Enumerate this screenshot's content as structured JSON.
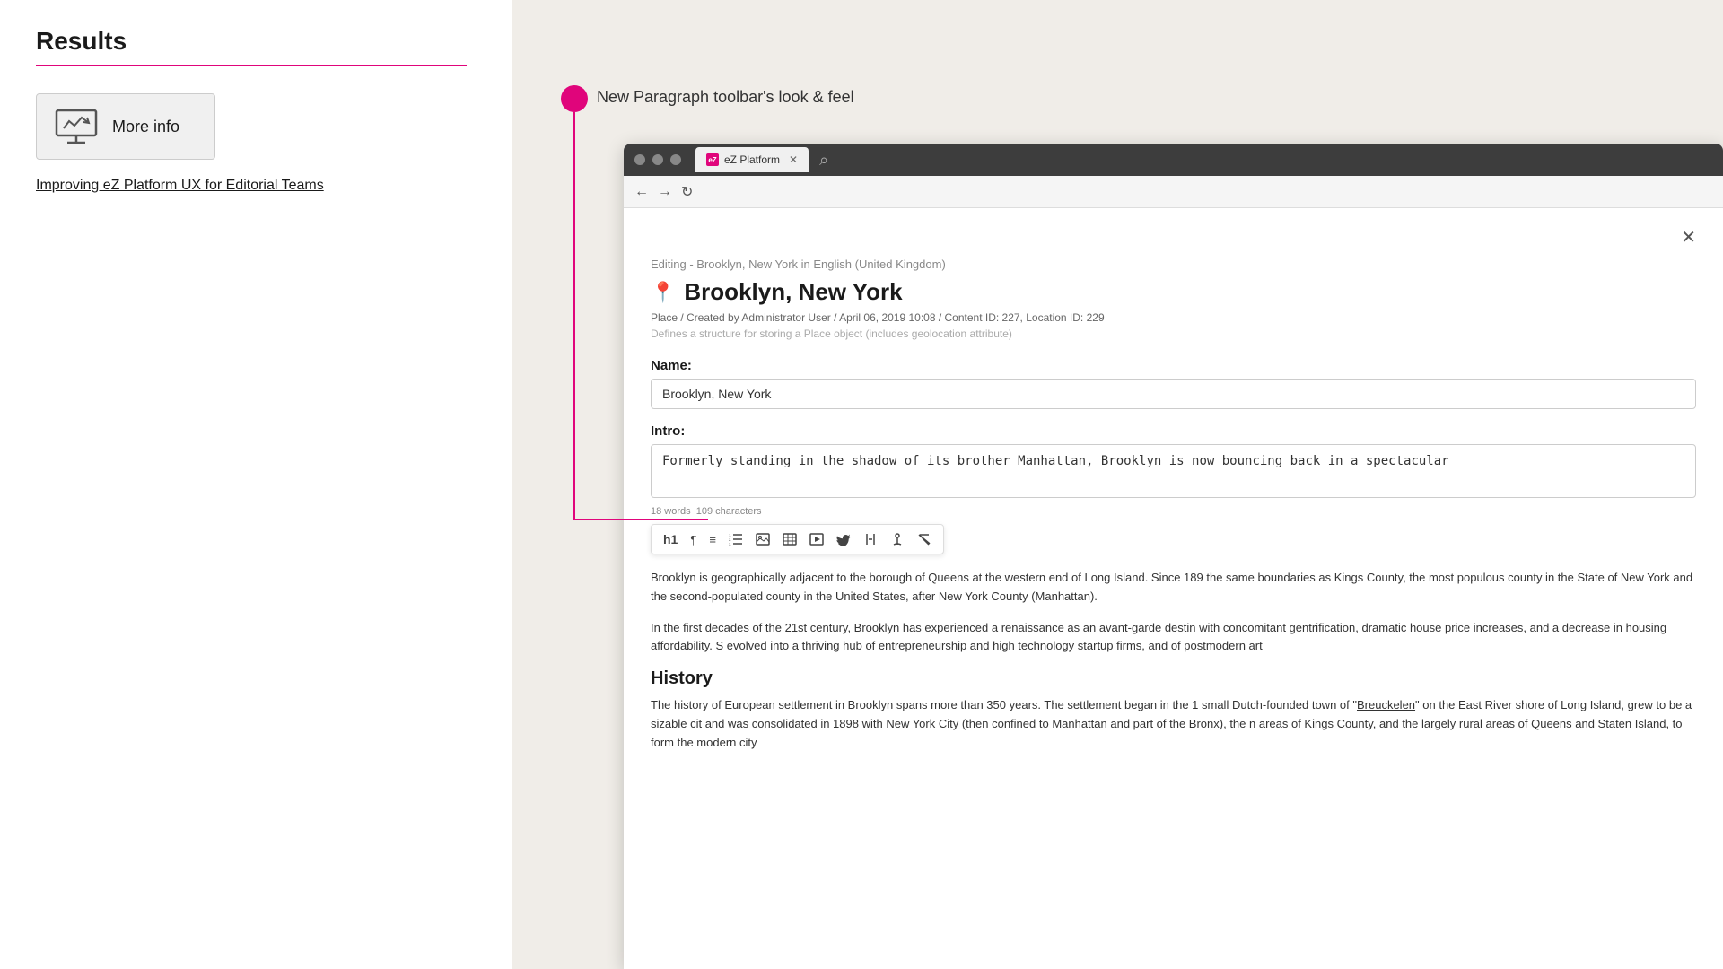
{
  "left": {
    "results_title": "Results",
    "more_info_label": "More info",
    "result_link": "Improving eZ Platform UX for Editorial Teams"
  },
  "right": {
    "timeline_label": "New Paragraph toolbar's look & feel",
    "browser": {
      "tab_label": "eZ Platform",
      "editing_label": "Editing - Brooklyn, New York in English (United Kingdom)",
      "location_title": "Brooklyn, New York",
      "meta_info": "Place / Created by Administrator User / April 06, 2019 10:08 / Content ID: 227, Location ID: 229",
      "meta_description": "Defines a structure for storing a Place object (includes geolocation attribute)",
      "name_label": "Name:",
      "name_value": "Brooklyn, New York",
      "intro_label": "Intro:",
      "intro_value": "Formerly standing in the shadow of its brother Manhattan, Brooklyn is now bouncing back in a spectacular",
      "word_count": "18 words",
      "char_count": "109 characters",
      "body_text_1": "Brooklyn is geographically adjacent to the borough of Queens at the western end of Long Island. Since 189 the same boundaries as Kings County, the most populous county in the State of New York and the second-populated county in the United States, after New York County (Manhattan).",
      "body_text_2": "In the first decades of the 21st century, Brooklyn has experienced a renaissance as an avant-garde destin with concomitant gentrification, dramatic house price increases, and a decrease in housing affordability. S evolved into a thriving hub of entrepreneurship and high technology startup firms, and of postmodern art",
      "history_heading": "History",
      "history_text": "The history of European settlement in Brooklyn spans more than 350 years. The settlement began in the 1 small Dutch-founded town of \"Breuckelen\" on the East River shore of Long Island, grew to be a sizable cit and was consolidated in 1898 with New York City (then confined to Manhattan and part of the Bronx), the n areas of Kings County, and the largely rural areas of Queens and Staten Island, to form the modern city",
      "toolbar_buttons": [
        "h1",
        "¶",
        "≡",
        "≡",
        "⬜",
        "⊞",
        "▣",
        "♡",
        "⊞",
        "⊡",
        "↙"
      ]
    }
  }
}
